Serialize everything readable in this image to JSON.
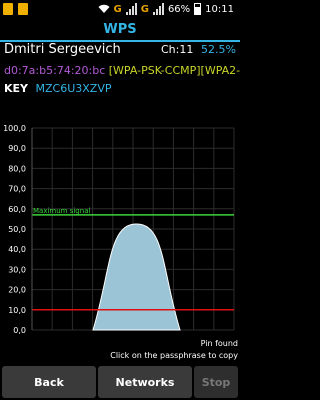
{
  "statusbar": {
    "network_g1": "G",
    "network_g2": "G",
    "battery": "66%",
    "time": "10:11"
  },
  "header": {
    "title": "WPS"
  },
  "network": {
    "ssid": "Dmitri Sergeevich",
    "channel": "Ch:11",
    "signal_percent": "52.5%",
    "mac": "d0:7a:b5:74:20:bc",
    "capabilities": "[WPA-PSK-CCMP][WPA2-",
    "key_label": "KEY",
    "key_value": "MZC6U3XZVP"
  },
  "chart_data": {
    "type": "area",
    "ylim": [
      0,
      100
    ],
    "y_ticks": [
      "100,0",
      "90,0",
      "80,0",
      "70,0",
      "60,0",
      "50,0",
      "40,0",
      "30,0",
      "20,0",
      "10,0",
      "0,0"
    ],
    "reference_lines": [
      {
        "label": "Maximum signal",
        "value": 57,
        "color": "#3ad63a"
      },
      {
        "label": "",
        "value": 10,
        "color": "#e01010"
      }
    ],
    "series": [
      {
        "values": [
          0,
          52.5,
          0
        ],
        "fill": "#9bc5d6",
        "stroke": "#ffffff"
      }
    ]
  },
  "footer": {
    "pin_status": "Pin found",
    "hint": "Click on the passphrase to copy"
  },
  "buttons": {
    "back": "Back",
    "networks": "Networks",
    "stop": "Stop"
  }
}
